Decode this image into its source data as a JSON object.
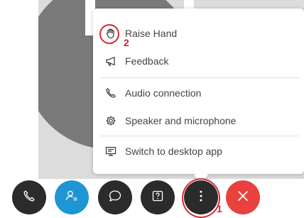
{
  "menu": {
    "items": [
      {
        "label": "Raise Hand",
        "icon": "raise-hand-icon"
      },
      {
        "label": "Feedback",
        "icon": "megaphone-icon"
      },
      {
        "label": "Audio connection",
        "icon": "phone-icon"
      },
      {
        "label": "Speaker and microphone",
        "icon": "gear-icon"
      },
      {
        "label": "Switch to desktop app",
        "icon": "desktop-app-icon"
      }
    ]
  },
  "annotations": {
    "step1": "1",
    "step2": "2",
    "color": "#d6292f"
  },
  "controls": [
    {
      "name": "audio",
      "icon": "phone-icon",
      "color": "#2b2b2b"
    },
    {
      "name": "participants",
      "icon": "participants-icon",
      "color": "#1e95d4"
    },
    {
      "name": "chat",
      "icon": "chat-bubble-icon",
      "color": "#2b2b2b"
    },
    {
      "name": "help",
      "icon": "help-icon",
      "color": "#2b2b2b"
    },
    {
      "name": "more",
      "icon": "more-vertical-icon",
      "color": "#2b2b2b"
    },
    {
      "name": "leave",
      "icon": "close-icon",
      "color": "#e8413e"
    }
  ]
}
